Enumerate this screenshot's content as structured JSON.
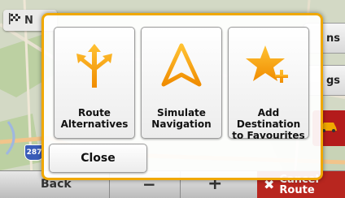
{
  "map": {
    "highway_shield": "287"
  },
  "top_left": {
    "flag_icon": "checkered-flag-icon",
    "text": "N"
  },
  "right_buttons": [
    {
      "label": "ns"
    },
    {
      "label": "gs"
    }
  ],
  "bottom_bar": {
    "back_label": "Back",
    "minus_label": "−",
    "plus_label": "+",
    "cancel_label_1": "Cancel",
    "cancel_label_2": "Route"
  },
  "dialog": {
    "options": [
      {
        "label_line1": "Route",
        "label_line2": "Alternatives",
        "icon": "route-alternatives-icon"
      },
      {
        "label_line1": "Simulate",
        "label_line2": "Navigation",
        "icon": "simulate-navigation-icon"
      },
      {
        "label_line1": "Add Destination",
        "label_line2": "to Favourites",
        "icon": "add-favourite-icon"
      }
    ],
    "close_label": "Close"
  },
  "colors": {
    "accent_orange": "#f0a800",
    "cancel_red": "#b8261f"
  }
}
